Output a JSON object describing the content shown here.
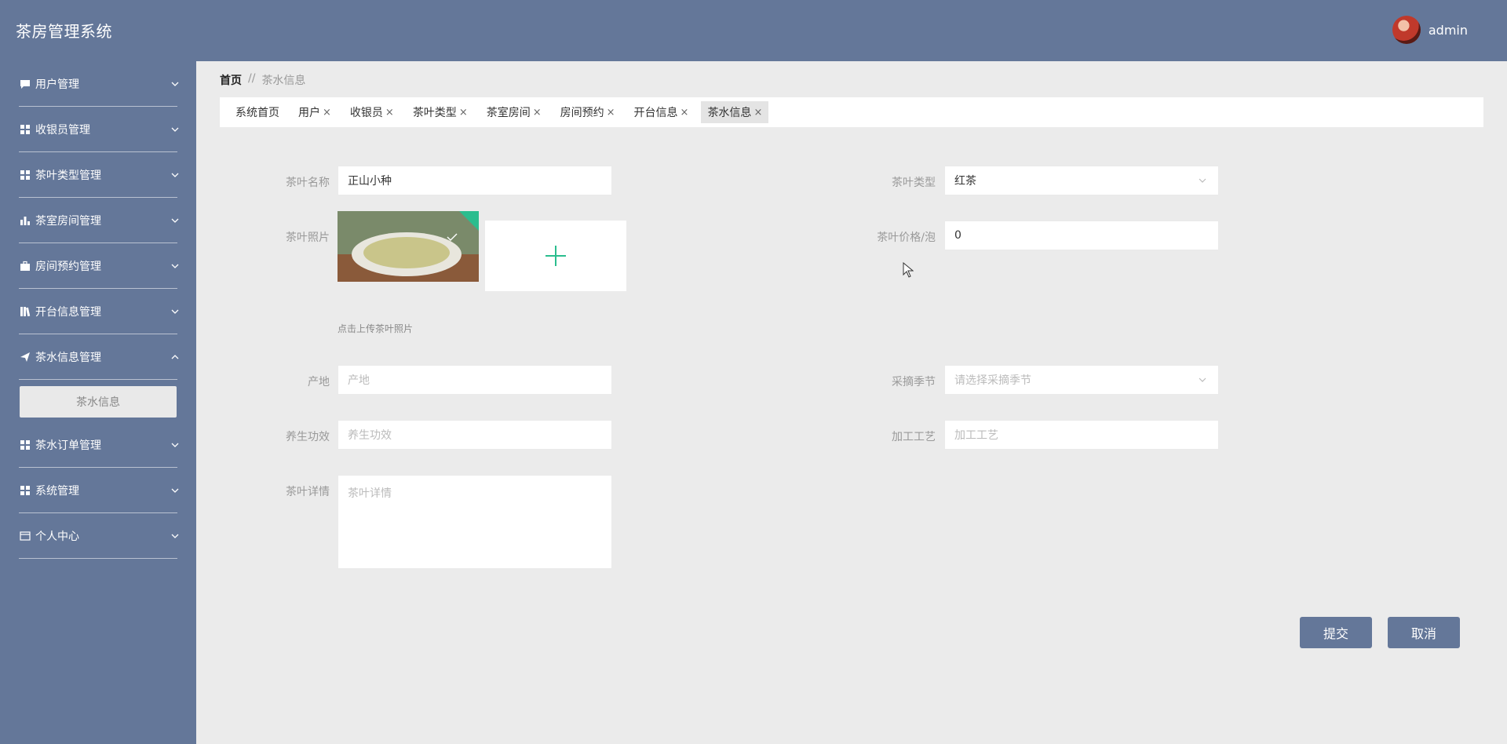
{
  "header": {
    "title": "茶房管理系统",
    "username": "admin"
  },
  "sidebar": {
    "items": [
      {
        "label": "用户管理",
        "icon": "chat-icon"
      },
      {
        "label": "收银员管理",
        "icon": "grid-icon"
      },
      {
        "label": "茶叶类型管理",
        "icon": "grid-icon"
      },
      {
        "label": "茶室房间管理",
        "icon": "bar-chart-icon"
      },
      {
        "label": "房间预约管理",
        "icon": "briefcase-icon"
      },
      {
        "label": "开台信息管理",
        "icon": "library-icon"
      },
      {
        "label": "茶水信息管理",
        "icon": "send-icon",
        "expanded": true,
        "subitems": [
          {
            "label": "茶水信息"
          }
        ]
      },
      {
        "label": "茶水订单管理",
        "icon": "grid-icon"
      },
      {
        "label": "系统管理",
        "icon": "grid-icon"
      },
      {
        "label": "个人中心",
        "icon": "card-icon"
      }
    ]
  },
  "breadcrumb": {
    "home": "首页",
    "separator": "//",
    "current": "茶水信息"
  },
  "tabs": [
    {
      "label": "系统首页",
      "closable": false
    },
    {
      "label": "用户",
      "closable": true
    },
    {
      "label": "收银员",
      "closable": true
    },
    {
      "label": "茶叶类型",
      "closable": true
    },
    {
      "label": "茶室房间",
      "closable": true
    },
    {
      "label": "房间预约",
      "closable": true
    },
    {
      "label": "开台信息",
      "closable": true
    },
    {
      "label": "茶水信息",
      "closable": true,
      "active": true
    }
  ],
  "tab_close_glyph": "×",
  "form": {
    "name": {
      "label": "茶叶名称",
      "value": "正山小种"
    },
    "type": {
      "label": "茶叶类型",
      "value": "红茶"
    },
    "photo": {
      "label": "茶叶照片",
      "hint": "点击上传茶叶照片"
    },
    "price": {
      "label": "茶叶价格/泡",
      "value": "0"
    },
    "origin": {
      "label": "产地",
      "placeholder": "产地"
    },
    "season": {
      "label": "采摘季节",
      "placeholder": "请选择采摘季节"
    },
    "benefit": {
      "label": "养生功效",
      "placeholder": "养生功效"
    },
    "process": {
      "label": "加工工艺",
      "placeholder": "加工工艺"
    },
    "detail": {
      "label": "茶叶详情",
      "placeholder": "茶叶详情"
    }
  },
  "buttons": {
    "submit": "提交",
    "cancel": "取消"
  },
  "colors": {
    "primary": "#647799",
    "background": "#ebebeb",
    "upload_accent": "#2bbd8e"
  }
}
